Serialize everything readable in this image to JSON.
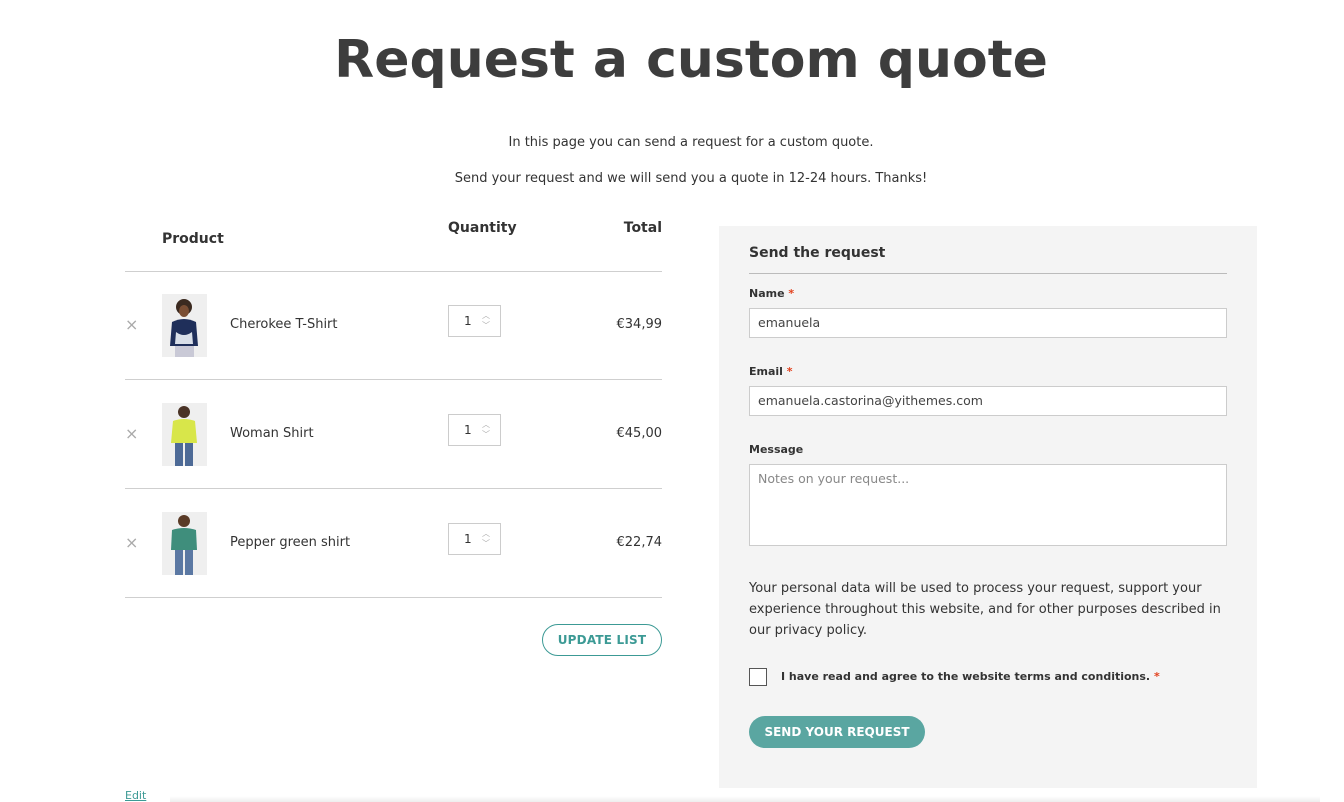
{
  "page": {
    "title": "Request a custom quote",
    "intro_line1": "In this page you can send a request for a custom quote.",
    "intro_line2": "Send your request and we will send you a quote in 12-24 hours. Thanks!"
  },
  "table": {
    "headers": {
      "product": "Product",
      "quantity": "Quantity",
      "total": "Total"
    },
    "rows": [
      {
        "name": "Cherokee T-Shirt",
        "quantity": "1",
        "total": "€34,99",
        "thumb_color": "#1f2f5a"
      },
      {
        "name": "Woman Shirt",
        "quantity": "1",
        "total": "€45,00",
        "thumb_color": "#d8e64a"
      },
      {
        "name": "Pepper green shirt",
        "quantity": "1",
        "total": "€22,74",
        "thumb_color": "#3f8e7c"
      }
    ],
    "remove_glyph": "×",
    "update_label": "UPDATE LIST"
  },
  "form": {
    "title": "Send the request",
    "name_label": "Name",
    "name_value": "emanuela",
    "email_label": "Email",
    "email_value": "emanuela.castorina@yithemes.com",
    "message_label": "Message",
    "message_placeholder": "Notes on your request...",
    "required_mark": "*",
    "privacy_text": "Your personal data will be used to process your request, support your experience throughout this website, and for other purposes described in our privacy policy.",
    "terms_label": "I have read and agree to the website terms and conditions.",
    "submit_label": "SEND YOUR REQUEST"
  },
  "footer": {
    "edit_label": "Edit"
  },
  "colors": {
    "accent": "#3c9a95",
    "button_fill": "#5aa6a1",
    "panel_bg": "#f4f4f4",
    "required": "#e2401c"
  }
}
